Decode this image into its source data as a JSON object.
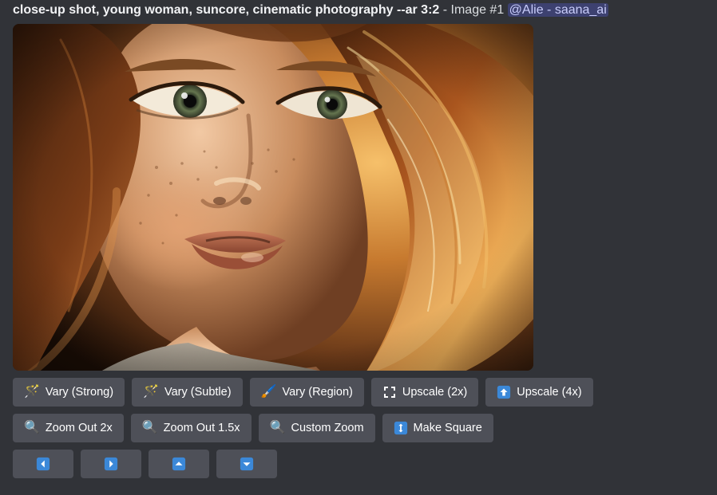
{
  "header": {
    "prompt": "close-up shot, young woman, suncore, cinematic photography --ar 3:2",
    "image_tag": " - Image #1 ",
    "mention": "@Alie - saana_ai"
  },
  "buttons": {
    "row1": {
      "vary_strong": "Vary (Strong)",
      "vary_subtle": "Vary (Subtle)",
      "vary_region": "Vary (Region)",
      "upscale_2x": "Upscale (2x)",
      "upscale_4x": "Upscale (4x)"
    },
    "row2": {
      "zoom_out_2x": "Zoom Out 2x",
      "zoom_out_15x": "Zoom Out 1.5x",
      "custom_zoom": "Custom Zoom",
      "make_square": "Make Square"
    }
  },
  "icons": {
    "wand_strong": "🪄",
    "wand_subtle": "🪄",
    "region": "🖌️",
    "expand": "⛶",
    "up_arrow_box": "⬆",
    "magnifier": "🔍",
    "resize": "↕"
  }
}
